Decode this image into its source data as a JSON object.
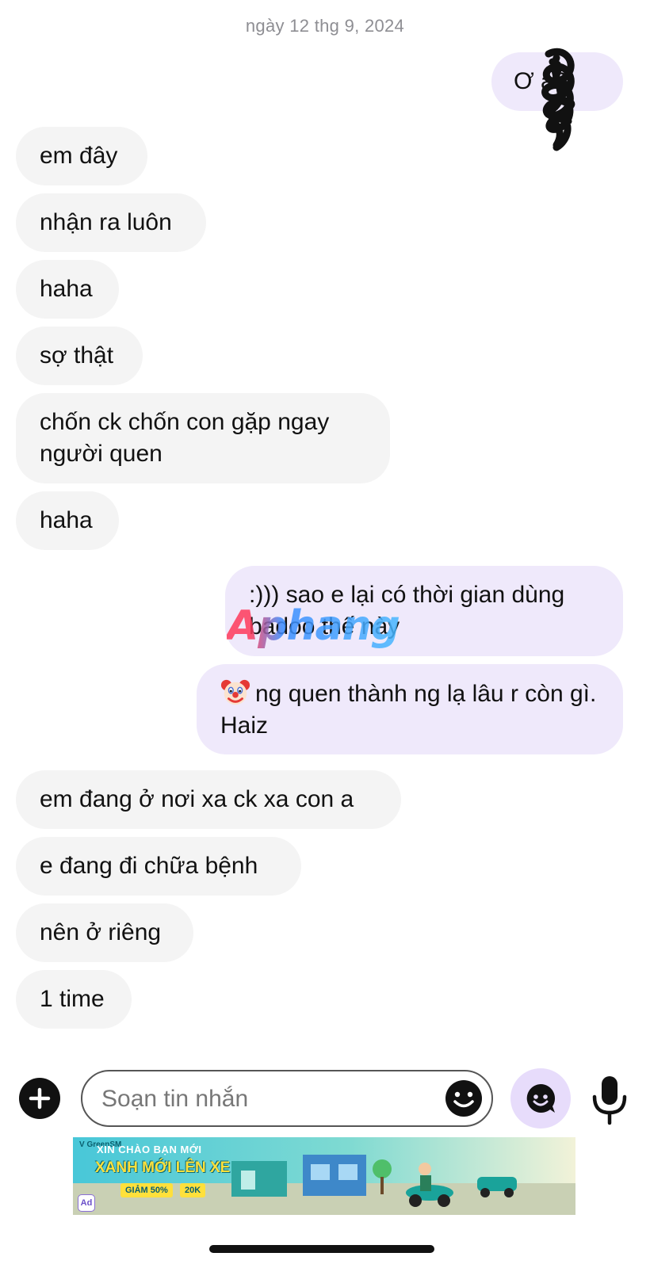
{
  "date_header": "ngày 12 thg 9, 2024",
  "messages": [
    {
      "side": "out",
      "text": "Ơ  à?"
    },
    {
      "side": "in",
      "text": "em đây"
    },
    {
      "side": "in",
      "text": "nhận ra luôn"
    },
    {
      "side": "in",
      "text": "haha"
    },
    {
      "side": "in",
      "text": "sợ thật"
    },
    {
      "side": "in",
      "text": "chốn ck chốn con gặp ngay người quen"
    },
    {
      "side": "in",
      "text": "haha"
    },
    {
      "side": "out",
      "text": ":))) sao e lại có thời gian dùng badoo thế này"
    },
    {
      "side": "out",
      "text": "ng quen thành ng lạ lâu r còn gì. Haiz",
      "emoji": "clown-face"
    },
    {
      "side": "in",
      "text": "em đang ở nơi xa ck xa con a"
    },
    {
      "side": "in",
      "text": "e đang đi chữa bệnh"
    },
    {
      "side": "in",
      "text": "nên ở riêng"
    },
    {
      "side": "in",
      "text": "1 time"
    }
  ],
  "watermark": "Aphang",
  "composer": {
    "placeholder": "Soạn tin nhắn"
  },
  "ad": {
    "brand": "V GreenSM",
    "line1": "XIN CHÀO BẠN MỚI",
    "line2": "XANH MỚI LÊN XE",
    "tag1": "GIẢM 50%",
    "tag2": "20K",
    "badge": "Ad"
  },
  "colors": {
    "incoming_bubble": "#f4f4f4",
    "outgoing_bubble": "#efe9fb",
    "accent": "#e7dcfb"
  }
}
